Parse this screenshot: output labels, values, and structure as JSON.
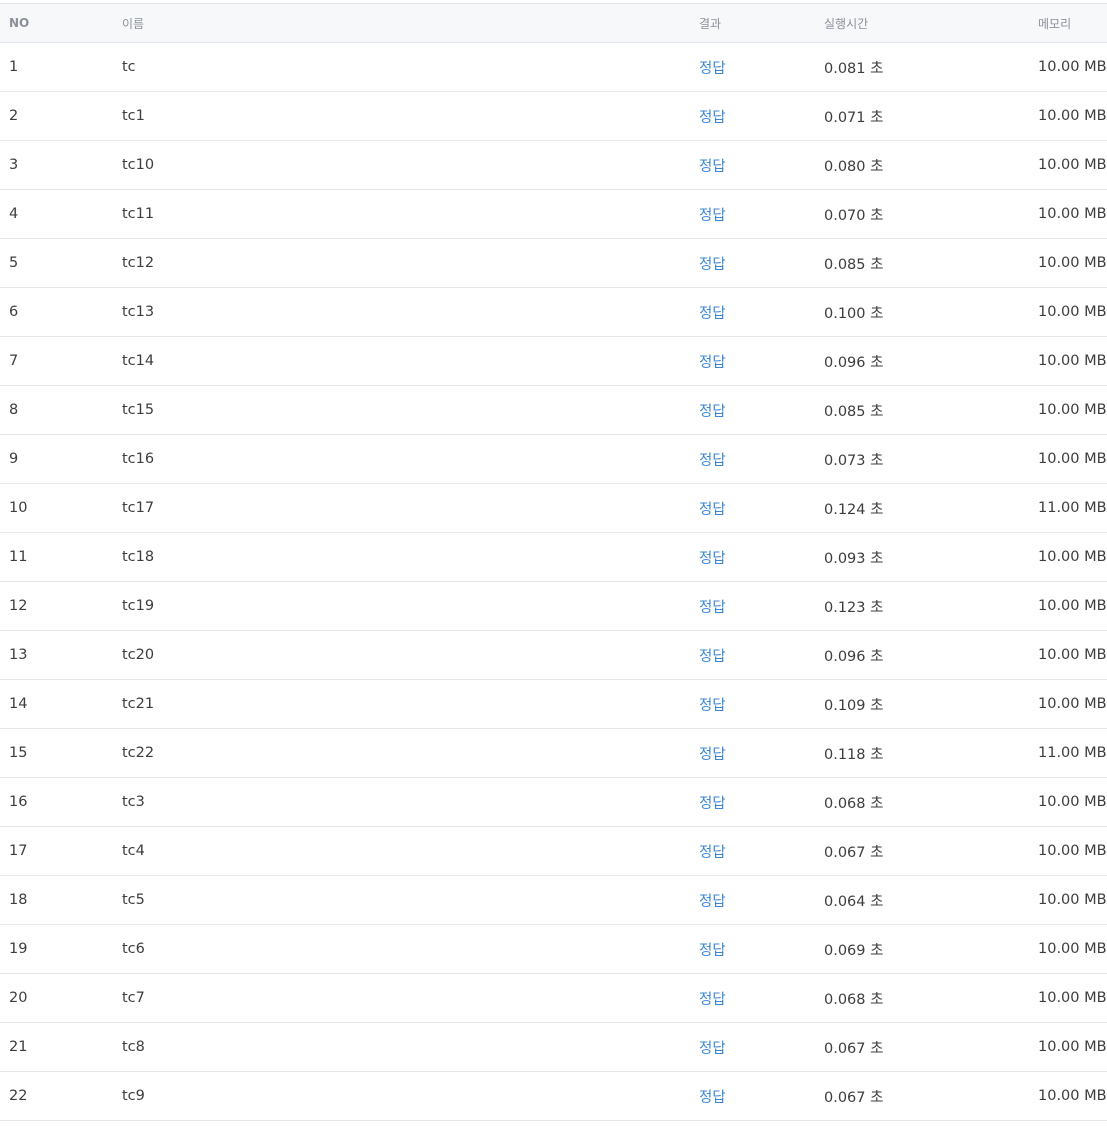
{
  "table": {
    "headers": {
      "no": "NO",
      "name": "이름",
      "result": "결과",
      "time": "실행시간",
      "memory": "메모리"
    },
    "rows": [
      {
        "no": "1",
        "name": "tc",
        "result": "정답",
        "time": "0.081 초",
        "memory": "10.00 MB"
      },
      {
        "no": "2",
        "name": "tc1",
        "result": "정답",
        "time": "0.071 초",
        "memory": "10.00 MB"
      },
      {
        "no": "3",
        "name": "tc10",
        "result": "정답",
        "time": "0.080 초",
        "memory": "10.00 MB"
      },
      {
        "no": "4",
        "name": "tc11",
        "result": "정답",
        "time": "0.070 초",
        "memory": "10.00 MB"
      },
      {
        "no": "5",
        "name": "tc12",
        "result": "정답",
        "time": "0.085 초",
        "memory": "10.00 MB"
      },
      {
        "no": "6",
        "name": "tc13",
        "result": "정답",
        "time": "0.100 초",
        "memory": "10.00 MB"
      },
      {
        "no": "7",
        "name": "tc14",
        "result": "정답",
        "time": "0.096 초",
        "memory": "10.00 MB"
      },
      {
        "no": "8",
        "name": "tc15",
        "result": "정답",
        "time": "0.085 초",
        "memory": "10.00 MB"
      },
      {
        "no": "9",
        "name": "tc16",
        "result": "정답",
        "time": "0.073 초",
        "memory": "10.00 MB"
      },
      {
        "no": "10",
        "name": "tc17",
        "result": "정답",
        "time": "0.124 초",
        "memory": "11.00 MB"
      },
      {
        "no": "11",
        "name": "tc18",
        "result": "정답",
        "time": "0.093 초",
        "memory": "10.00 MB"
      },
      {
        "no": "12",
        "name": "tc19",
        "result": "정답",
        "time": "0.123 초",
        "memory": "10.00 MB"
      },
      {
        "no": "13",
        "name": "tc20",
        "result": "정답",
        "time": "0.096 초",
        "memory": "10.00 MB"
      },
      {
        "no": "14",
        "name": "tc21",
        "result": "정답",
        "time": "0.109 초",
        "memory": "10.00 MB"
      },
      {
        "no": "15",
        "name": "tc22",
        "result": "정답",
        "time": "0.118 초",
        "memory": "11.00 MB"
      },
      {
        "no": "16",
        "name": "tc3",
        "result": "정답",
        "time": "0.068 초",
        "memory": "10.00 MB"
      },
      {
        "no": "17",
        "name": "tc4",
        "result": "정답",
        "time": "0.067 초",
        "memory": "10.00 MB"
      },
      {
        "no": "18",
        "name": "tc5",
        "result": "정답",
        "time": "0.064 초",
        "memory": "10.00 MB"
      },
      {
        "no": "19",
        "name": "tc6",
        "result": "정답",
        "time": "0.069 초",
        "memory": "10.00 MB"
      },
      {
        "no": "20",
        "name": "tc7",
        "result": "정답",
        "time": "0.068 초",
        "memory": "10.00 MB"
      },
      {
        "no": "21",
        "name": "tc8",
        "result": "정답",
        "time": "0.067 초",
        "memory": "10.00 MB"
      },
      {
        "no": "22",
        "name": "tc9",
        "result": "정답",
        "time": "0.067 초",
        "memory": "10.00 MB"
      }
    ]
  },
  "colors": {
    "header_bg": "#f7f8fa",
    "header_text": "#8b9098",
    "row_border": "#e5e7ea",
    "result_link": "#3b86d6"
  }
}
